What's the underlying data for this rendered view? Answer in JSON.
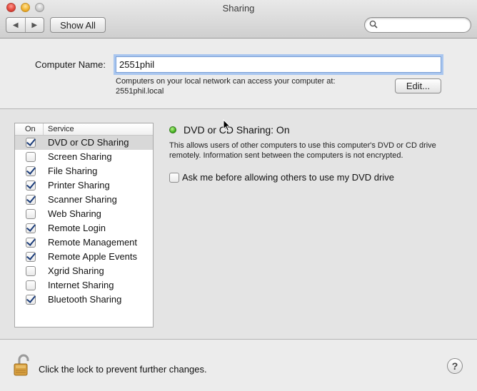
{
  "window": {
    "title": "Sharing"
  },
  "toolbar": {
    "back_icon": "left-arrow-icon",
    "forward_icon": "right-arrow-icon",
    "back_glyph": "◀",
    "forward_glyph": "▶",
    "show_all_label": "Show All",
    "search_placeholder": "",
    "search_value": ""
  },
  "computer_name": {
    "label": "Computer Name:",
    "value": "2551phil",
    "info_line1": "Computers on your local network can access your computer at:",
    "info_line2": "2551phil.local",
    "edit_label": "Edit..."
  },
  "services": {
    "header_on": "On",
    "header_service": "Service",
    "items": [
      {
        "name": "DVD or CD Sharing",
        "checked": true,
        "selected": true
      },
      {
        "name": "Screen Sharing",
        "checked": false,
        "selected": false
      },
      {
        "name": "File Sharing",
        "checked": true,
        "selected": false
      },
      {
        "name": "Printer Sharing",
        "checked": true,
        "selected": false
      },
      {
        "name": "Scanner Sharing",
        "checked": true,
        "selected": false
      },
      {
        "name": "Web Sharing",
        "checked": false,
        "selected": false
      },
      {
        "name": "Remote Login",
        "checked": true,
        "selected": false
      },
      {
        "name": "Remote Management",
        "checked": true,
        "selected": false
      },
      {
        "name": "Remote Apple Events",
        "checked": true,
        "selected": false
      },
      {
        "name": "Xgrid Sharing",
        "checked": false,
        "selected": false
      },
      {
        "name": "Internet Sharing",
        "checked": false,
        "selected": false
      },
      {
        "name": "Bluetooth Sharing",
        "checked": true,
        "selected": false
      }
    ]
  },
  "detail": {
    "status_color": "#3fae1c",
    "status_text": "DVD or CD Sharing: On",
    "description": "This allows users of other computers to use this computer's DVD or CD drive remotely. Information sent between the computers is not encrypted.",
    "ask_label": "Ask me before allowing others to use my DVD drive",
    "ask_checked": false
  },
  "footer": {
    "lock_text": "Click the lock to prevent further changes.",
    "help_label": "?"
  }
}
